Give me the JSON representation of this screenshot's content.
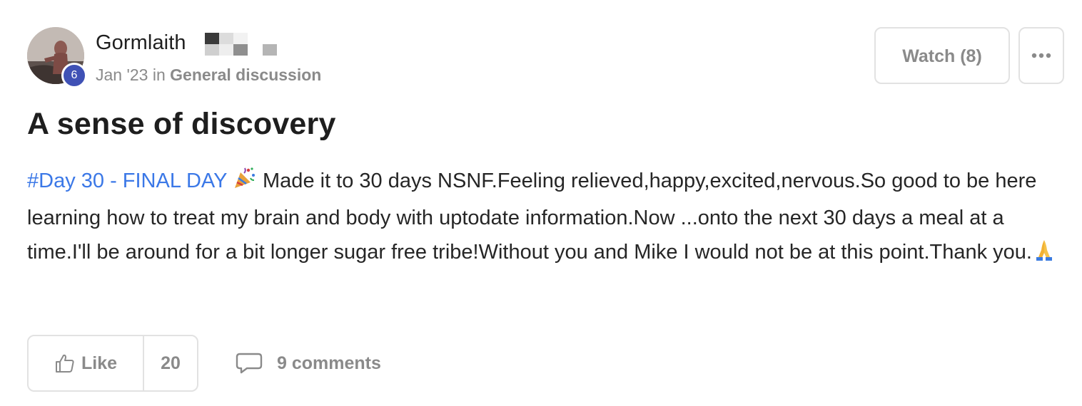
{
  "author": {
    "name": "Gormlaith",
    "level": "6",
    "avatar_icon": "user-avatar-photo"
  },
  "meta": {
    "date": "Jan '23",
    "in_word": "in",
    "category": "General discussion"
  },
  "actions": {
    "watch_label": "Watch (8)",
    "more_icon": "ellipsis-icon"
  },
  "post": {
    "title": "A sense of discovery",
    "hashtag": "#Day 30 - FINAL DAY",
    "body_main": " Made it to 30 days NSNF.Feeling relieved,happy,excited,nervous.So good to be here learning how to treat my brain and body with uptodate information.Now ...onto the next 30 days a meal at a time.I'll be around for a bit longer sugar free tribe!Without you and Mike I would not be at this point.Thank you.",
    "emoji_1": "party-popper",
    "emoji_2": "folded-hands"
  },
  "footer": {
    "like_label": "Like",
    "like_count": "20",
    "comments_label": "9 comments"
  },
  "colors": {
    "accent_link": "#3b78e7",
    "badge": "#3f51b5",
    "muted": "#8a8a8a",
    "border": "#e2e2e2"
  }
}
